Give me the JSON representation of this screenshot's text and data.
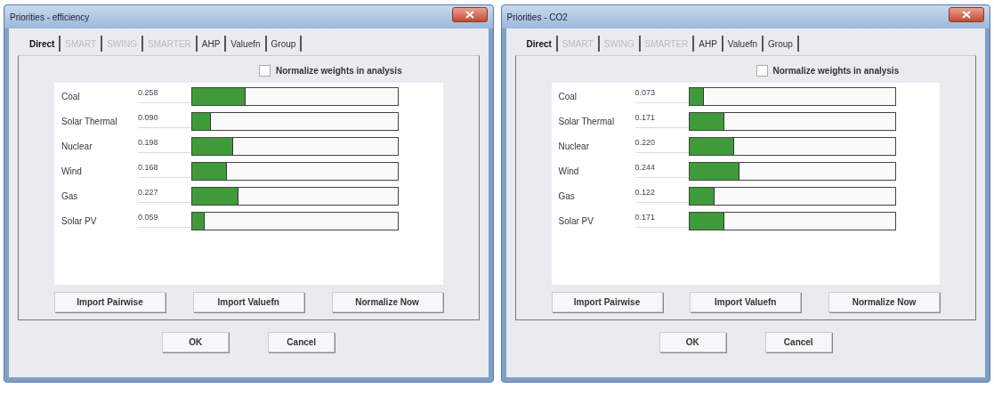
{
  "windows": [
    {
      "title": "Priorities - efficiency",
      "tabs": [
        {
          "label": "Direct",
          "selected": true,
          "disabled": false
        },
        {
          "label": "SMART",
          "selected": false,
          "disabled": true
        },
        {
          "label": "SWING",
          "selected": false,
          "disabled": true
        },
        {
          "label": "SMARTER",
          "selected": false,
          "disabled": true
        },
        {
          "label": "AHP",
          "selected": false,
          "disabled": false
        },
        {
          "label": "Valuefn",
          "selected": false,
          "disabled": false
        },
        {
          "label": "Group",
          "selected": false,
          "disabled": false
        }
      ],
      "normalize": {
        "label": "Normalize weights in analysis",
        "checked": false
      },
      "rows": [
        {
          "name": "Coal",
          "value": "0.258",
          "level": 0.258
        },
        {
          "name": "Solar Thermal",
          "value": "0.090",
          "level": 0.09
        },
        {
          "name": "Nuclear",
          "value": "0.198",
          "level": 0.198
        },
        {
          "name": "Wind",
          "value": "0.168",
          "level": 0.168
        },
        {
          "name": "Gas",
          "value": "0.227",
          "level": 0.227
        },
        {
          "name": "Solar PV",
          "value": "0.059",
          "level": 0.059
        }
      ],
      "panel_buttons": [
        "Import Pairwise",
        "Import Valuefn",
        "Normalize Now"
      ],
      "buttons": [
        "OK",
        "Cancel"
      ]
    },
    {
      "title": "Priorities - CO2",
      "tabs": [
        {
          "label": "Direct",
          "selected": true,
          "disabled": false
        },
        {
          "label": "SMART",
          "selected": false,
          "disabled": true
        },
        {
          "label": "SWING",
          "selected": false,
          "disabled": true
        },
        {
          "label": "SMARTER",
          "selected": false,
          "disabled": true
        },
        {
          "label": "AHP",
          "selected": false,
          "disabled": false
        },
        {
          "label": "Valuefn",
          "selected": false,
          "disabled": false
        },
        {
          "label": "Group",
          "selected": false,
          "disabled": false
        }
      ],
      "normalize": {
        "label": "Normalize weights in analysis",
        "checked": false
      },
      "rows": [
        {
          "name": "Coal",
          "value": "0.073",
          "level": 0.073
        },
        {
          "name": "Solar Thermal",
          "value": "0.171",
          "level": 0.171
        },
        {
          "name": "Nuclear",
          "value": "0.220",
          "level": 0.22
        },
        {
          "name": "Wind",
          "value": "0.244",
          "level": 0.244
        },
        {
          "name": "Gas",
          "value": "0.122",
          "level": 0.122
        },
        {
          "name": "Solar PV",
          "value": "0.171",
          "level": 0.171
        }
      ],
      "panel_buttons": [
        "Import Pairwise",
        "Import Valuefn",
        "Normalize Now"
      ],
      "buttons": [
        "OK",
        "Cancel"
      ]
    }
  ]
}
